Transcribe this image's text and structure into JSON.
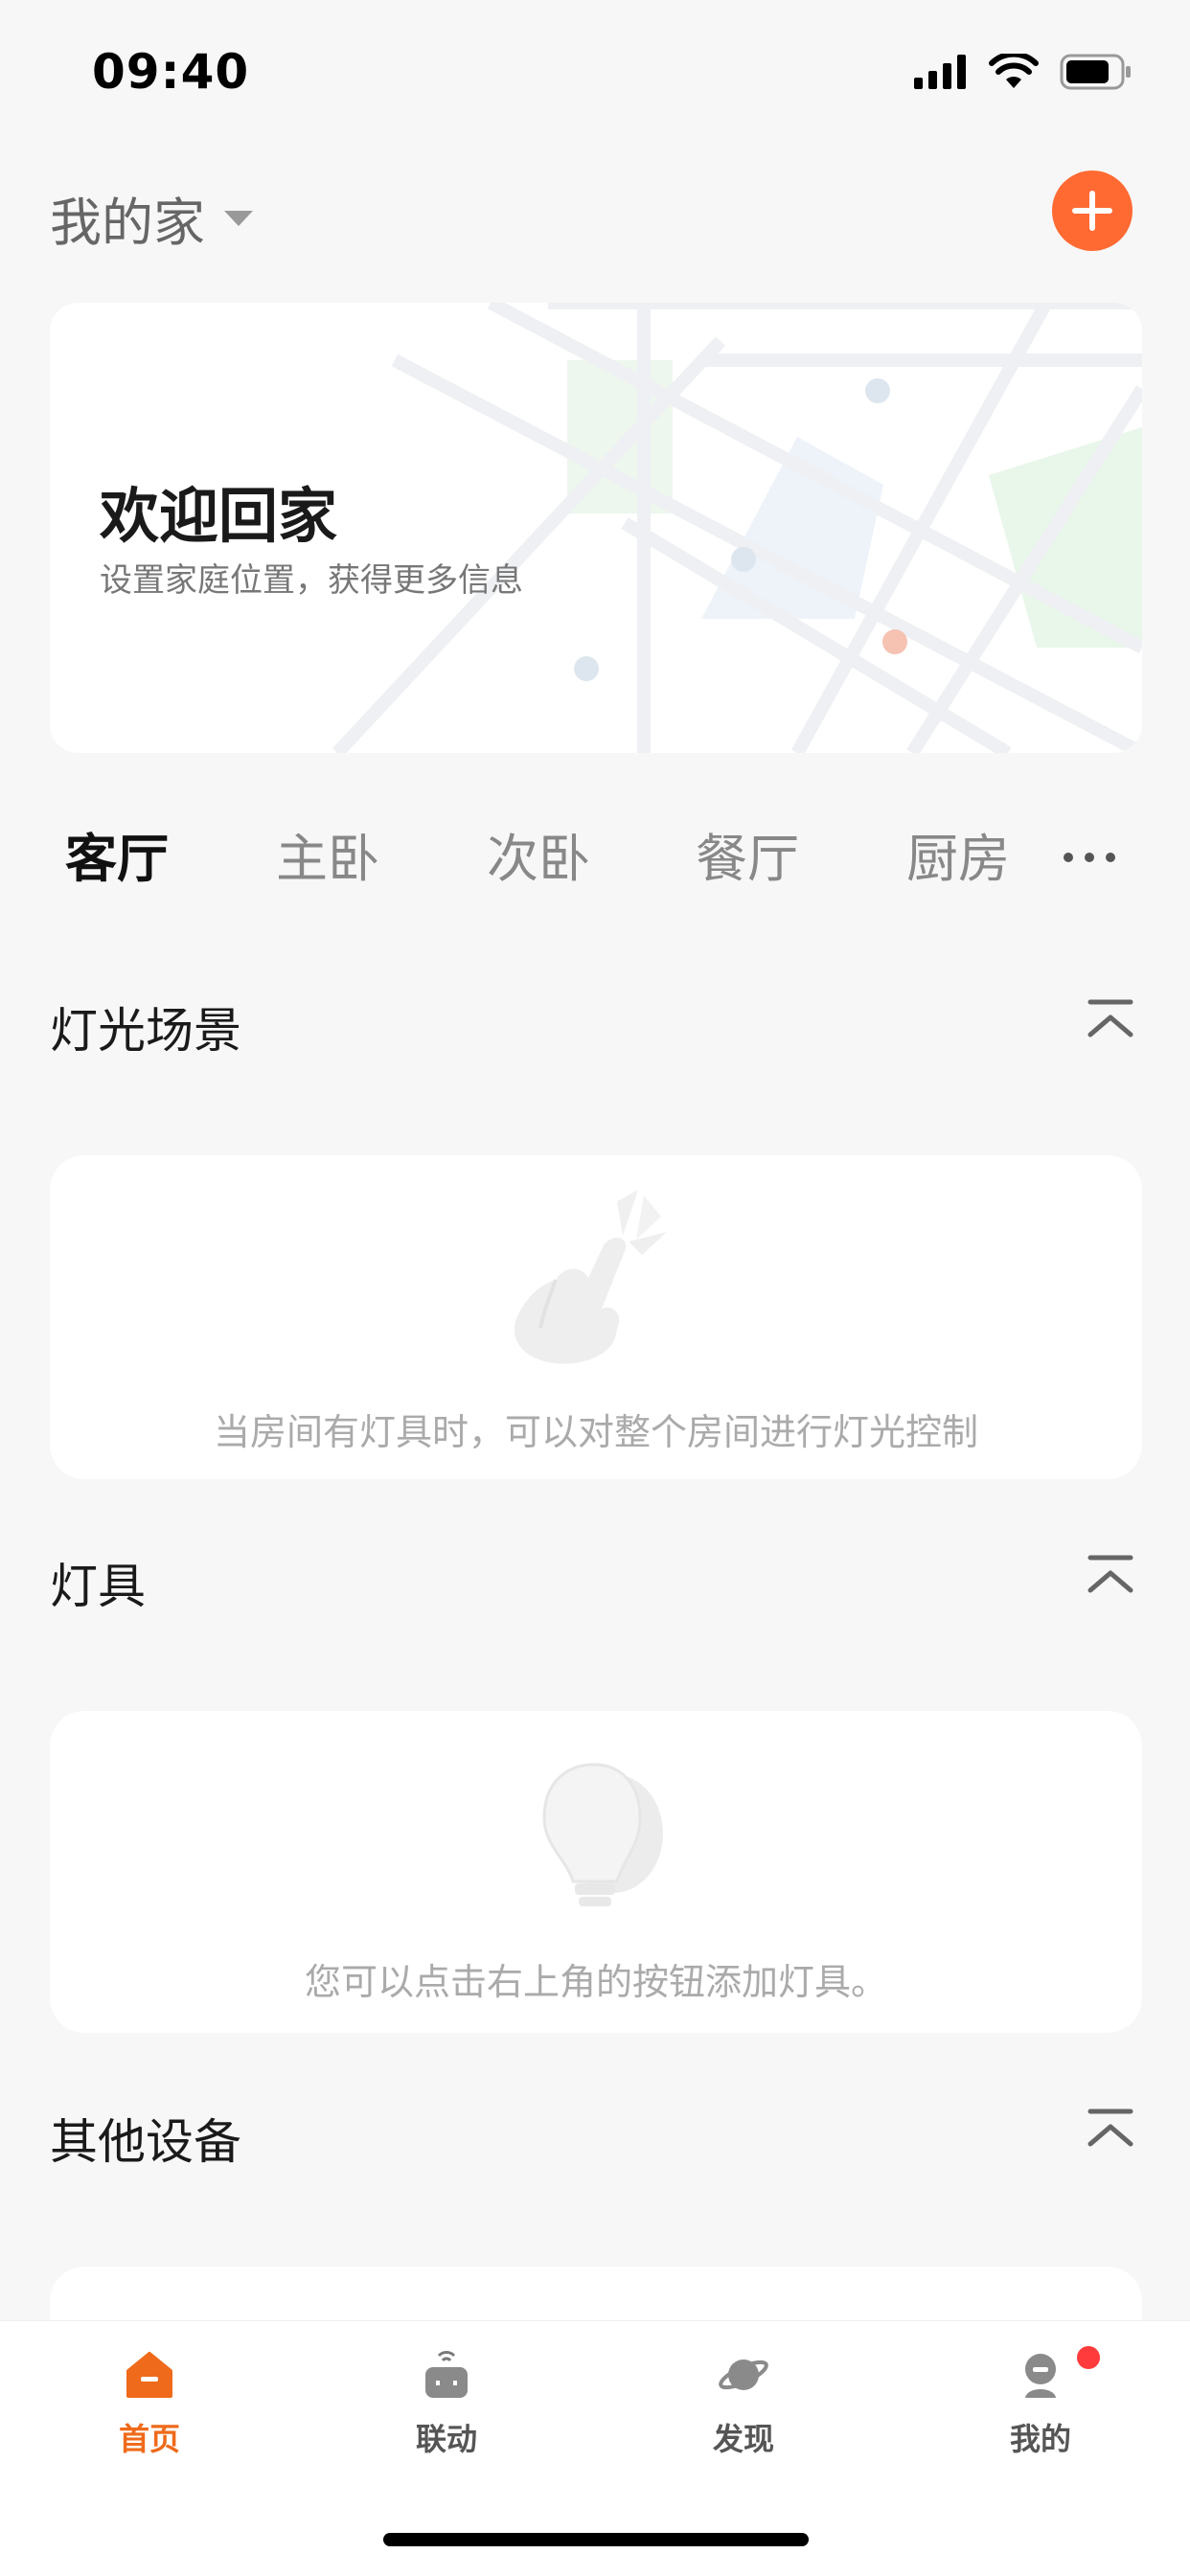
{
  "status_bar": {
    "time": "09:40"
  },
  "header": {
    "home_name": "我的家"
  },
  "welcome": {
    "title": "欢迎回家",
    "subtitle": "设置家庭位置，获得更多信息"
  },
  "rooms": {
    "tabs": [
      {
        "label": "客厅",
        "active": true
      },
      {
        "label": "主卧"
      },
      {
        "label": "次卧"
      },
      {
        "label": "餐厅"
      },
      {
        "label": "厨房"
      }
    ]
  },
  "sections": {
    "scenes": {
      "title": "灯光场景",
      "empty_text": "当房间有灯具时，可以对整个房间进行灯光控制"
    },
    "lights": {
      "title": "灯具",
      "empty_text": "您可以点击右上角的按钮添加灯具。"
    },
    "others": {
      "title": "其他设备"
    }
  },
  "bottom_nav": {
    "items": [
      {
        "label": "首页",
        "icon": "home-icon",
        "active": true
      },
      {
        "label": "联动",
        "icon": "robot-icon"
      },
      {
        "label": "发现",
        "icon": "planet-icon"
      },
      {
        "label": "我的",
        "icon": "profile-icon",
        "badge": true
      }
    ]
  },
  "colors": {
    "accent": "#ff6a33",
    "nav_active": "#ef6a1a",
    "badge": "#ff3b3b"
  }
}
